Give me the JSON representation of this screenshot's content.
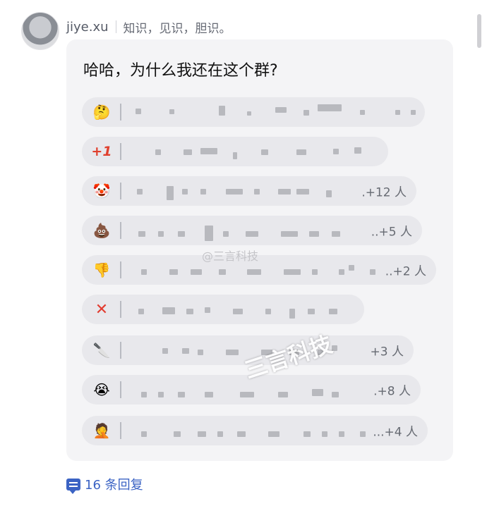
{
  "post": {
    "username": "jiye.xu",
    "bio": "知识，见识，胆识。"
  },
  "poll": {
    "question": "哈哈，为什么我还在这个群?",
    "options": [
      {
        "icon": "thinking-face-icon",
        "emoji": "🤔",
        "count": ""
      },
      {
        "icon": "plus-one-icon",
        "emoji": "+1",
        "count": ""
      },
      {
        "icon": "clown-face-icon",
        "emoji": "🤡",
        "count": ".+12 人"
      },
      {
        "icon": "pile-of-poo-icon",
        "emoji": "💩",
        "count": "..+5 人"
      },
      {
        "icon": "thumbs-down-icon",
        "emoji": "👎",
        "count": "..+2 人"
      },
      {
        "icon": "cross-mark-icon",
        "emoji": "✕",
        "count": ""
      },
      {
        "icon": "knife-icon",
        "emoji": "🔪",
        "count": "+3 人"
      },
      {
        "icon": "crying-face-icon",
        "emoji": "😭",
        "count": ".+8 人"
      },
      {
        "icon": "face-palm-icon",
        "emoji": "🤦",
        "count": "...+4 人"
      }
    ]
  },
  "footer": {
    "reply_count": "16 条回复"
  },
  "watermarks": {
    "weibo": "@三言科技",
    "center": "三言科技"
  },
  "colors": {
    "accent": "#3b63c4",
    "card_bg": "#f4f4f6",
    "option_bg": "#e8e8ec"
  }
}
